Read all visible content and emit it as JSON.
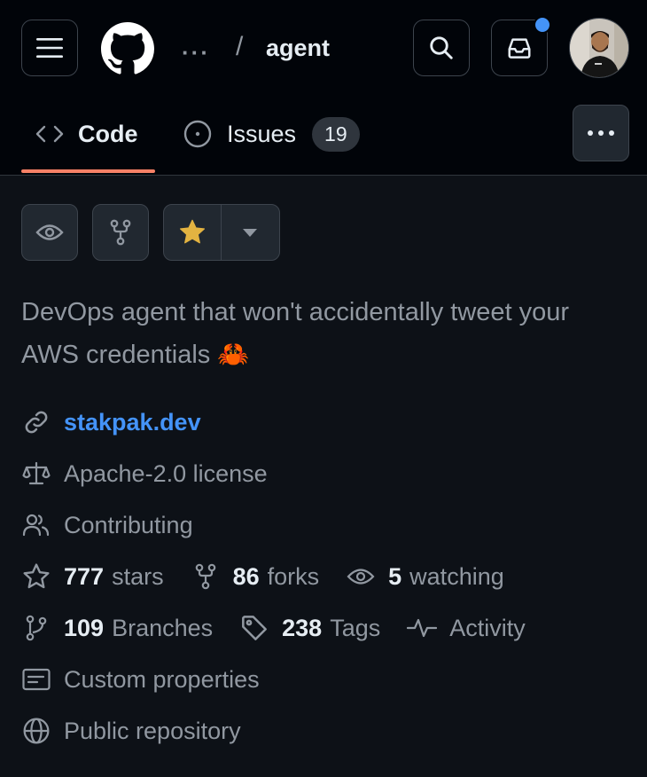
{
  "header": {
    "breadcrumb_ellipsis": "···",
    "breadcrumb_separator": "/",
    "repo_name": "agent",
    "has_unread_notifications": true,
    "notification_color": "#4493f8"
  },
  "tabs": [
    {
      "label": "Code",
      "selected": true
    },
    {
      "label": "Issues",
      "count": "19",
      "selected": false
    }
  ],
  "tab_underline_color": "#f78166",
  "actions": {
    "watch_icon": "eye-icon",
    "fork_icon": "repo-forked-icon",
    "star_icon": "star-fill-icon",
    "star_color": "#e3b341",
    "dropdown_icon": "triangle-down-icon"
  },
  "about": {
    "description": "DevOps agent that won't accidentally tweet your AWS credentials 🦀",
    "website": "stakpak.dev",
    "license": "Apache-2.0 license",
    "contributing": "Contributing",
    "stars": {
      "count": "777",
      "label": "stars"
    },
    "forks": {
      "count": "86",
      "label": "forks"
    },
    "watching": {
      "count": "5",
      "label": "watching"
    },
    "branches": {
      "count": "109",
      "label": "Branches"
    },
    "tags": {
      "count": "238",
      "label": "Tags"
    },
    "activity": "Activity",
    "custom_properties": "Custom properties",
    "visibility": "Public repository"
  },
  "colors": {
    "background": "#0d1117",
    "header_background": "#010409",
    "link": "#4493f8",
    "muted_text": "#9198a1"
  }
}
